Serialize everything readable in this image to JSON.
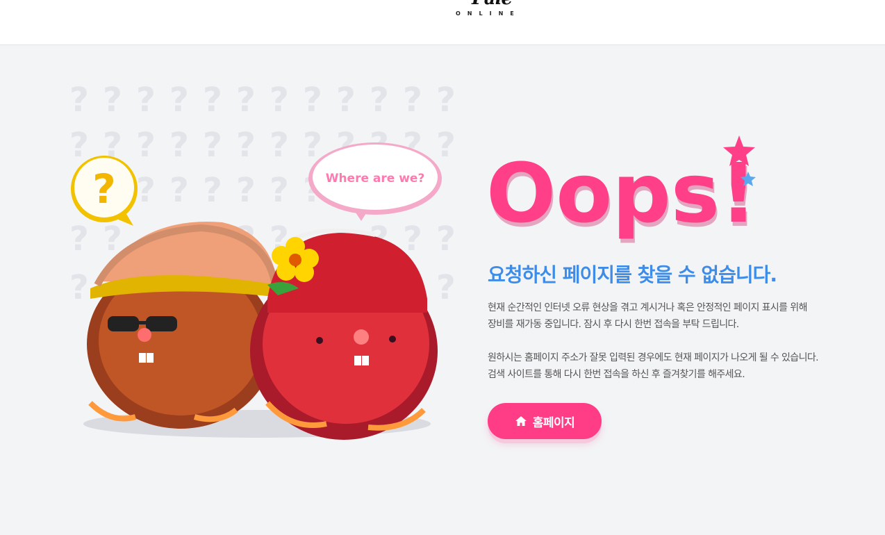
{
  "header": {
    "logo_text": "Pale",
    "logo_sub": "ONLINE"
  },
  "illustration": {
    "speech_bubble": "Where are we?",
    "question_mark": "?"
  },
  "error": {
    "title": "Oops!",
    "headline": "요청하신 페이지를 찾을 수 없습니다.",
    "paragraph1": [
      "현재 순간적인 인터넷 오류 현상을 겪고 계시거나 혹은 안정적인 페이지 표시를 위해",
      "장비를 재가동 중입니다. 잠시 후 다시 한번 접속을 부탁 드립니다."
    ],
    "paragraph2": [
      "원하시는 홈페이지 주소가 잘못 입력된 경우에도 현재 페이지가 나오게 될 수 있습니다.",
      "검색 사이트를 통해 다시 한번 접속을 하신 후 즐겨찾기를 해주세요."
    ]
  },
  "home_button": {
    "label": "홈페이지",
    "icon": "home-icon"
  },
  "colors": {
    "accent_pink": "#ff3d86",
    "headline_blue": "#3d8de8",
    "background": "#f3f4f6"
  }
}
